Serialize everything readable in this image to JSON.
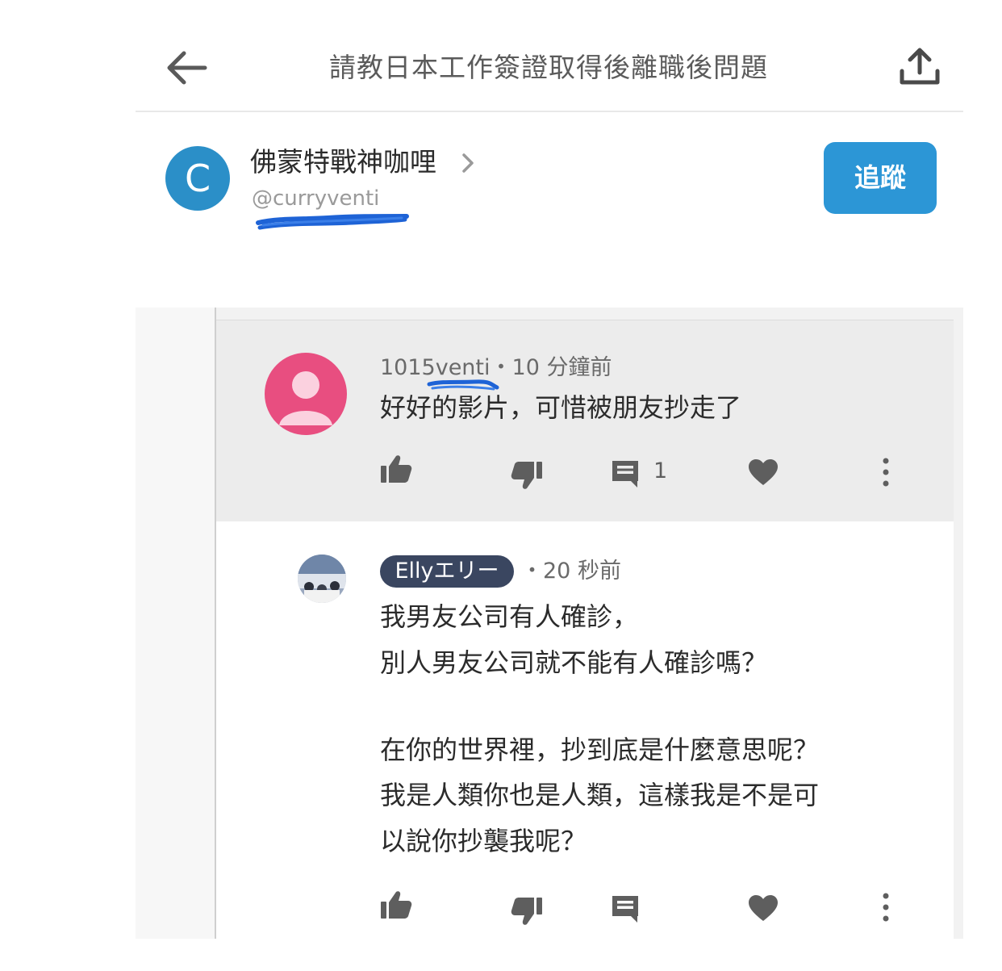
{
  "header": {
    "title": "請教日本工作簽證取得後離職後問題",
    "back_icon": "back-arrow-icon",
    "share_icon": "share-upload-icon"
  },
  "author": {
    "avatar_letter": "C",
    "avatar_color": "#2b8fc8",
    "name": "佛蒙特戰神咖哩",
    "handle": "@curryventi",
    "follow_label": "追蹤",
    "follow_color": "#2c96d6"
  },
  "comment": {
    "username": "1015venti",
    "separator": "・",
    "time": "10 分鐘前",
    "text": "好好的影片，可惜被朋友抄走了",
    "avatar_color": "#e84e80",
    "reply_count": "1"
  },
  "reply": {
    "username": "Ellyエリー",
    "time": "・20 秒前",
    "lines": [
      "我男友公司有人確診，",
      "別人男友公司就不能有人確診嗎？",
      "",
      "在你的世界裡，抄到底是什麼意思呢？",
      "我是人類你也是人類，這樣我是不是可",
      "以說你抄襲我呢？"
    ]
  },
  "annotations": {
    "scribble_color": "#1e63d6"
  }
}
